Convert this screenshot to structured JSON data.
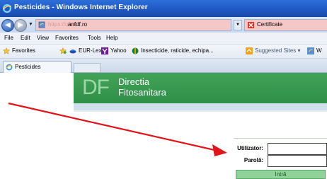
{
  "window": {
    "title": "Pesticides - Windows Internet Explorer"
  },
  "address_bar": {
    "url_prefix": "https://ulise.",
    "url_host": "anfdf.ro",
    "certificate_label": "Certificate"
  },
  "menu": [
    "File",
    "Edit",
    "View",
    "Favorites",
    "Tools",
    "Help"
  ],
  "favorites_bar": {
    "favorites_label": "Favorites",
    "links": [
      "EUR-Lex",
      "Yahoo",
      "Insecticide, raticide, echipa...",
      "Suggested Sites ▾",
      "W"
    ]
  },
  "tabs": [
    {
      "label": "Pesticides"
    }
  ],
  "site": {
    "logo_mark": "DF",
    "logo_line1": "Directia",
    "logo_line2": "Fitosanitara"
  },
  "login": {
    "user_label": "Utilizator:",
    "user_value": "",
    "password_label": "Parolă:",
    "password_value": "",
    "submit_label": "Intră"
  },
  "colors": {
    "annotation_arrow": "#e0141a",
    "banner_green": "#3a9a50",
    "login_button": "#8fd39a"
  }
}
